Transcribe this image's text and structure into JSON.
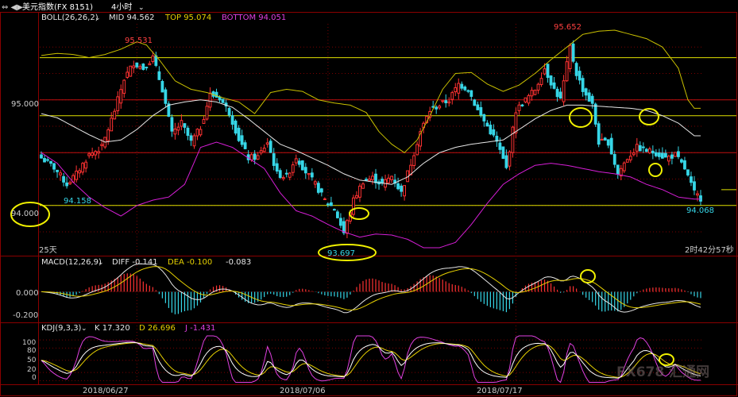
{
  "header": {
    "instrument": "美元指数(FX 8151)",
    "timeframe": "4小时",
    "boll_label": "BOLL(26,26,2)",
    "mid": "MID 94.562",
    "top": "TOP 95.074",
    "bottom": "BOTTOM 94.051"
  },
  "price_panel": {
    "ylim": [
      93.6,
      95.72
    ],
    "left_ticks": [
      {
        "value": 95.0,
        "label": "95.000"
      },
      {
        "value": 94.0,
        "label": "94.000"
      }
    ],
    "annotations": [
      {
        "label": "95.531"
      },
      {
        "label": "95.652"
      },
      {
        "label": "94.158"
      },
      {
        "label": "93.697"
      },
      {
        "label": "94.068"
      }
    ],
    "period_label": "25天",
    "countdown": "2时42分57秒"
  },
  "macd_panel": {
    "label": "MACD(12,26,9)",
    "diff": "DIFF -0.141",
    "dea": "DEA -0.100",
    "macd": "-0.083",
    "ylim": [
      -0.26,
      0.19
    ],
    "ticks": [
      {
        "value": 0.0,
        "label": "0.000"
      },
      {
        "value": -0.2,
        "label": "-0.200"
      }
    ]
  },
  "kdj_panel": {
    "label": "KDJ(9,3,3)",
    "k": "K 17.320",
    "d": "D 26.696",
    "j": "J -1.431",
    "ylim": [
      -5,
      112
    ],
    "ticks": [
      {
        "value": 100,
        "label": "100"
      },
      {
        "value": 80,
        "label": "80"
      },
      {
        "value": 50,
        "label": "50"
      },
      {
        "value": 20,
        "label": "20"
      },
      {
        "value": 0,
        "label": "0"
      }
    ]
  },
  "x_axis": {
    "labels": [
      {
        "index": 30,
        "label": "2018/06/27"
      },
      {
        "index": 90,
        "label": "2018/07/06"
      },
      {
        "index": 149,
        "label": "2018/07/17"
      }
    ]
  },
  "watermark": "FX678 汇通网",
  "colors": {
    "up": "#ff3232",
    "down": "#36d6e7",
    "boll_upper": "#c9c000",
    "boll_mid": "#e6e6e6",
    "boll_lower": "#d61ed6",
    "dea": "#e6d000",
    "kdj_k": "#ffffff",
    "kdj_d": "#e6d000",
    "kdj_j": "#e040e0",
    "grid": "#7a0000",
    "level_line": "#e0e000",
    "circle": "#f0f000"
  },
  "chart_data": {
    "type": "candlestick",
    "ohlc_anchors": [
      [
        0,
        94.45
      ],
      [
        4,
        94.36
      ],
      [
        8,
        94.2
      ],
      [
        11,
        94.3
      ],
      [
        15,
        94.48
      ],
      [
        19,
        94.55
      ],
      [
        23,
        94.9
      ],
      [
        26,
        95.2
      ],
      [
        29,
        95.35
      ],
      [
        32,
        95.3
      ],
      [
        35,
        95.4
      ],
      [
        38,
        95.1
      ],
      [
        41,
        94.68
      ],
      [
        44,
        94.78
      ],
      [
        47,
        94.6
      ],
      [
        50,
        94.74
      ],
      [
        53,
        95.05
      ],
      [
        56,
        95.02
      ],
      [
        59,
        94.88
      ],
      [
        62,
        94.63
      ],
      [
        65,
        94.45
      ],
      [
        68,
        94.46
      ],
      [
        71,
        94.6
      ],
      [
        74,
        94.3
      ],
      [
        77,
        94.27
      ],
      [
        80,
        94.46
      ],
      [
        83,
        94.32
      ],
      [
        86,
        94.2
      ],
      [
        89,
        94.05
      ],
      [
        92,
        93.97
      ],
      [
        95,
        93.74
      ],
      [
        98,
        94.05
      ],
      [
        101,
        94.23
      ],
      [
        104,
        94.26
      ],
      [
        107,
        94.2
      ],
      [
        110,
        94.28
      ],
      [
        113,
        94.12
      ],
      [
        116,
        94.4
      ],
      [
        119,
        94.7
      ],
      [
        122,
        94.9
      ],
      [
        125,
        94.95
      ],
      [
        128,
        95.0
      ],
      [
        131,
        95.15
      ],
      [
        134,
        95.1
      ],
      [
        137,
        94.9
      ],
      [
        140,
        94.75
      ],
      [
        143,
        94.6
      ],
      [
        146,
        94.35
      ],
      [
        149,
        94.9
      ],
      [
        152,
        95.0
      ],
      [
        155,
        95.1
      ],
      [
        158,
        95.3
      ],
      [
        161,
        95.1
      ],
      [
        163,
        95.0
      ],
      [
        166,
        95.5
      ],
      [
        168,
        95.25
      ],
      [
        170,
        95.1
      ],
      [
        173,
        94.95
      ],
      [
        175,
        94.6
      ],
      [
        178,
        94.6
      ],
      [
        181,
        94.3
      ],
      [
        184,
        94.45
      ],
      [
        187,
        94.55
      ],
      [
        190,
        94.52
      ],
      [
        193,
        94.5
      ],
      [
        196,
        94.45
      ],
      [
        199,
        94.48
      ],
      [
        202,
        94.35
      ],
      [
        205,
        94.12
      ],
      [
        207,
        94.07
      ]
    ],
    "boll_upper_anchors": [
      [
        0,
        95.42
      ],
      [
        5,
        95.44
      ],
      [
        10,
        95.43
      ],
      [
        15,
        95.4
      ],
      [
        20,
        95.43
      ],
      [
        25,
        95.48
      ],
      [
        30,
        95.55
      ],
      [
        33,
        95.52
      ],
      [
        37,
        95.38
      ],
      [
        42,
        95.18
      ],
      [
        47,
        95.1
      ],
      [
        52,
        95.07
      ],
      [
        57,
        95.02
      ],
      [
        62,
        94.98
      ],
      [
        67,
        94.87
      ],
      [
        72,
        95.07
      ],
      [
        77,
        95.1
      ],
      [
        82,
        95.08
      ],
      [
        87,
        95.0
      ],
      [
        92,
        94.97
      ],
      [
        97,
        94.95
      ],
      [
        102,
        94.88
      ],
      [
        106,
        94.7
      ],
      [
        110,
        94.58
      ],
      [
        114,
        94.5
      ],
      [
        118,
        94.62
      ],
      [
        122,
        94.85
      ],
      [
        126,
        95.1
      ],
      [
        130,
        95.25
      ],
      [
        135,
        95.26
      ],
      [
        140,
        95.15
      ],
      [
        145,
        95.08
      ],
      [
        150,
        95.14
      ],
      [
        155,
        95.25
      ],
      [
        160,
        95.38
      ],
      [
        165,
        95.5
      ],
      [
        170,
        95.62
      ],
      [
        175,
        95.65
      ],
      [
        180,
        95.66
      ],
      [
        185,
        95.62
      ],
      [
        190,
        95.58
      ],
      [
        195,
        95.5
      ],
      [
        200,
        95.3
      ],
      [
        203,
        95.0
      ],
      [
        205,
        94.92
      ]
    ],
    "boll_mid_anchors": [
      [
        0,
        94.87
      ],
      [
        5,
        94.83
      ],
      [
        10,
        94.75
      ],
      [
        15,
        94.67
      ],
      [
        20,
        94.6
      ],
      [
        25,
        94.62
      ],
      [
        30,
        94.72
      ],
      [
        35,
        94.85
      ],
      [
        40,
        94.95
      ],
      [
        45,
        94.98
      ],
      [
        50,
        95.0
      ],
      [
        55,
        94.98
      ],
      [
        60,
        94.93
      ],
      [
        65,
        94.82
      ],
      [
        70,
        94.7
      ],
      [
        75,
        94.58
      ],
      [
        80,
        94.52
      ],
      [
        85,
        94.45
      ],
      [
        90,
        94.38
      ],
      [
        95,
        94.3
      ],
      [
        100,
        94.24
      ],
      [
        105,
        94.22
      ],
      [
        110,
        94.2
      ],
      [
        115,
        94.27
      ],
      [
        120,
        94.4
      ],
      [
        125,
        94.5
      ],
      [
        130,
        94.55
      ],
      [
        135,
        94.58
      ],
      [
        140,
        94.6
      ],
      [
        145,
        94.62
      ],
      [
        150,
        94.72
      ],
      [
        155,
        94.82
      ],
      [
        160,
        94.9
      ],
      [
        165,
        94.95
      ],
      [
        170,
        94.95
      ],
      [
        175,
        94.94
      ],
      [
        180,
        94.93
      ],
      [
        185,
        94.92
      ],
      [
        190,
        94.9
      ],
      [
        195,
        94.85
      ],
      [
        200,
        94.78
      ],
      [
        205,
        94.66
      ]
    ],
    "boll_lower_anchors": [
      [
        0,
        94.5
      ],
      [
        5,
        94.4
      ],
      [
        10,
        94.22
      ],
      [
        15,
        94.08
      ],
      [
        20,
        93.98
      ],
      [
        25,
        93.9
      ],
      [
        30,
        94.0
      ],
      [
        35,
        94.05
      ],
      [
        40,
        94.08
      ],
      [
        45,
        94.2
      ],
      [
        50,
        94.55
      ],
      [
        55,
        94.6
      ],
      [
        60,
        94.55
      ],
      [
        65,
        94.45
      ],
      [
        70,
        94.35
      ],
      [
        75,
        94.12
      ],
      [
        80,
        93.95
      ],
      [
        85,
        93.9
      ],
      [
        90,
        93.82
      ],
      [
        95,
        93.75
      ],
      [
        100,
        93.7
      ],
      [
        105,
        93.73
      ],
      [
        110,
        93.72
      ],
      [
        115,
        93.68
      ],
      [
        120,
        93.6
      ],
      [
        125,
        93.6
      ],
      [
        130,
        93.65
      ],
      [
        135,
        93.82
      ],
      [
        140,
        94.02
      ],
      [
        145,
        94.2
      ],
      [
        150,
        94.3
      ],
      [
        155,
        94.38
      ],
      [
        160,
        94.4
      ],
      [
        165,
        94.38
      ],
      [
        170,
        94.35
      ],
      [
        175,
        94.32
      ],
      [
        180,
        94.3
      ],
      [
        185,
        94.27
      ],
      [
        190,
        94.2
      ],
      [
        195,
        94.15
      ],
      [
        200,
        94.08
      ],
      [
        205,
        94.06
      ]
    ],
    "bar_count": 208
  }
}
